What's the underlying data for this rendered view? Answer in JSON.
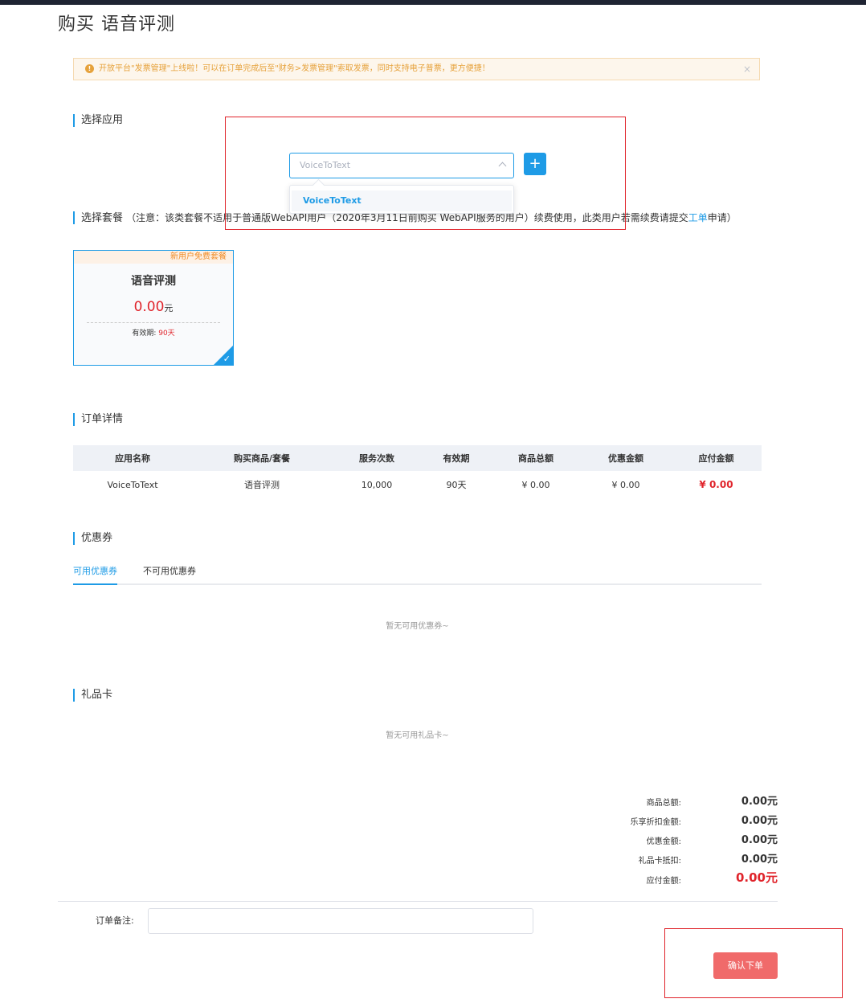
{
  "page": {
    "title": "购买 语音评测"
  },
  "notice": {
    "text": "开放平台\"发票管理\"上线啦！可以在订单完成后至\"财务>发票管理\"索取发票，同时支持电子普票，更方便捷！",
    "icon": "warning-icon",
    "close": "×"
  },
  "select_app": {
    "section_title": "选择应用",
    "placeholder": "VoiceToText",
    "add_label": "+",
    "dropdown_options": [
      "VoiceToText"
    ]
  },
  "select_package": {
    "section_title": "选择套餐",
    "note_prefix": "（注意：该类套餐不适用于普通版WebAPI用户（2020年3月11日前购买 WebAPI服务的用户）续费使用，此类用户若需续费请提交",
    "note_link": "工单",
    "note_suffix": "申请）",
    "card": {
      "badge": "新用户免费套餐",
      "name": "语音评测",
      "price": "0.00",
      "price_unit": "元",
      "validity_label": "有效期:",
      "validity_value": "90天"
    }
  },
  "order": {
    "section_title": "订单详情",
    "columns": [
      "应用名称",
      "购买商品/套餐",
      "服务次数",
      "有效期",
      "商品总额",
      "优惠金额",
      "应付金额"
    ],
    "row": [
      "VoiceToText",
      "语音评测",
      "10,000",
      "90天",
      "¥ 0.00",
      "¥ 0.00",
      "¥ 0.00"
    ]
  },
  "coupons": {
    "section_title": "优惠券",
    "tabs": [
      "可用优惠券",
      "不可用优惠券"
    ],
    "empty": "暂无可用优惠券~"
  },
  "giftcard": {
    "section_title": "礼品卡",
    "empty": "暂无可用礼品卡~"
  },
  "summary": [
    {
      "label": "商品总额:",
      "value": "0.00元"
    },
    {
      "label": "乐享折扣金额:",
      "value": "0.00元"
    },
    {
      "label": "优惠金额:",
      "value": "0.00元"
    },
    {
      "label": "礼品卡抵扣:",
      "value": "0.00元"
    },
    {
      "label": "应付金额:",
      "value": "0.00元"
    }
  ],
  "remark": {
    "label": "订单备注:",
    "value": ""
  },
  "confirm": {
    "label": "确认下单"
  },
  "colors": {
    "accent": "#1e9be6",
    "price_red": "#e0242b",
    "confirm_button": "#f06a6a",
    "annotation_red": "#e0242b"
  }
}
